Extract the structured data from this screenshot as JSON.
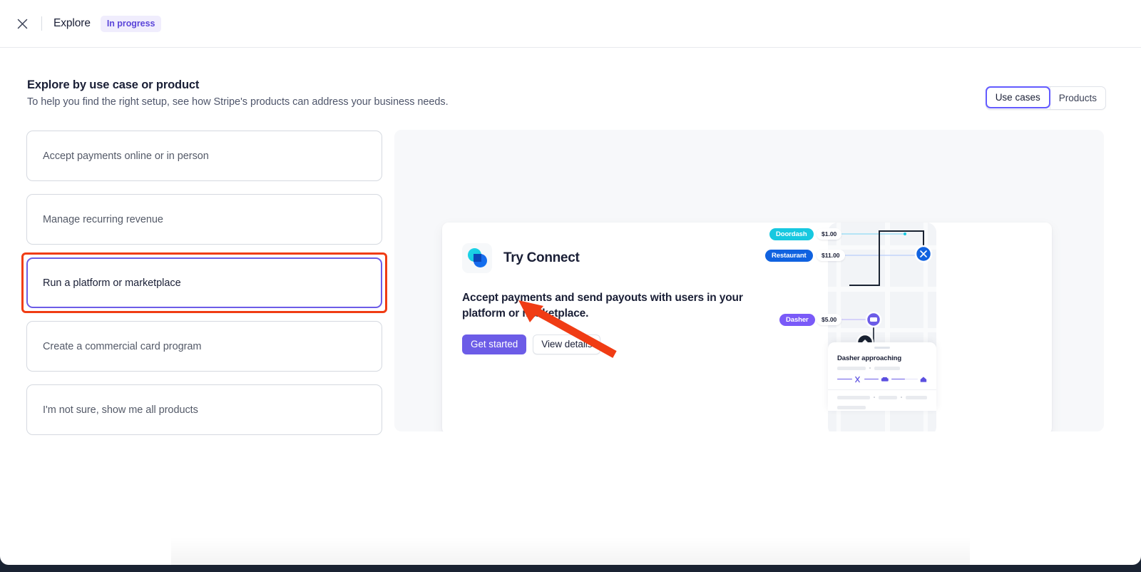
{
  "topbar": {
    "close_icon": "close-icon",
    "title": "Explore",
    "badge": "In progress"
  },
  "page": {
    "title": "Explore by use case or product",
    "subtitle": "To help you find the right setup, see how Stripe's products can address your business needs."
  },
  "segmented": {
    "options": [
      {
        "label": "Use cases",
        "selected": true
      },
      {
        "label": "Products",
        "selected": false
      }
    ]
  },
  "use_cases": [
    {
      "label": "Accept payments online or in person",
      "selected": false
    },
    {
      "label": "Manage recurring revenue",
      "selected": false
    },
    {
      "label": "Run a platform or marketplace",
      "selected": true
    },
    {
      "label": "Create a commercial card program",
      "selected": false
    },
    {
      "label": "I'm not sure, show me all products",
      "selected": false
    }
  ],
  "preview": {
    "logo_icon": "stripe-connect-logo-icon",
    "title": "Try Connect",
    "description": "Accept payments and send payouts with users in your platform or marketplace.",
    "primary_button": "Get started",
    "secondary_button": "View details"
  },
  "illustration": {
    "splits": [
      {
        "name": "Doordash",
        "amount": "$1.00",
        "color": "#17c8e0"
      },
      {
        "name": "Restaurant",
        "amount": "$11.00",
        "color": "#1062e0"
      },
      {
        "name": "Dasher",
        "amount": "$5.00",
        "color": "#7a5af8"
      }
    ],
    "sheet_title": "Dasher approaching",
    "map_pins": [
      {
        "name": "restaurant-pin",
        "icon": "cutlery-icon",
        "color": "#1062e0"
      },
      {
        "name": "dasher-pin",
        "icon": "car-icon",
        "color": "#6c5ce7"
      },
      {
        "name": "home-pin",
        "icon": "home-icon",
        "color": "#1a2332"
      }
    ]
  },
  "annotations": {
    "highlight_target": "Run a platform or marketplace",
    "arrow_target": "Get started",
    "color": "#f03c14"
  },
  "colors": {
    "accent_purple": "#6c5ce7",
    "badge_purple": "#5b46d9",
    "text_dark": "#1a1f36",
    "text_muted": "#4f566b",
    "panel_bg": "#f7f8fa"
  }
}
